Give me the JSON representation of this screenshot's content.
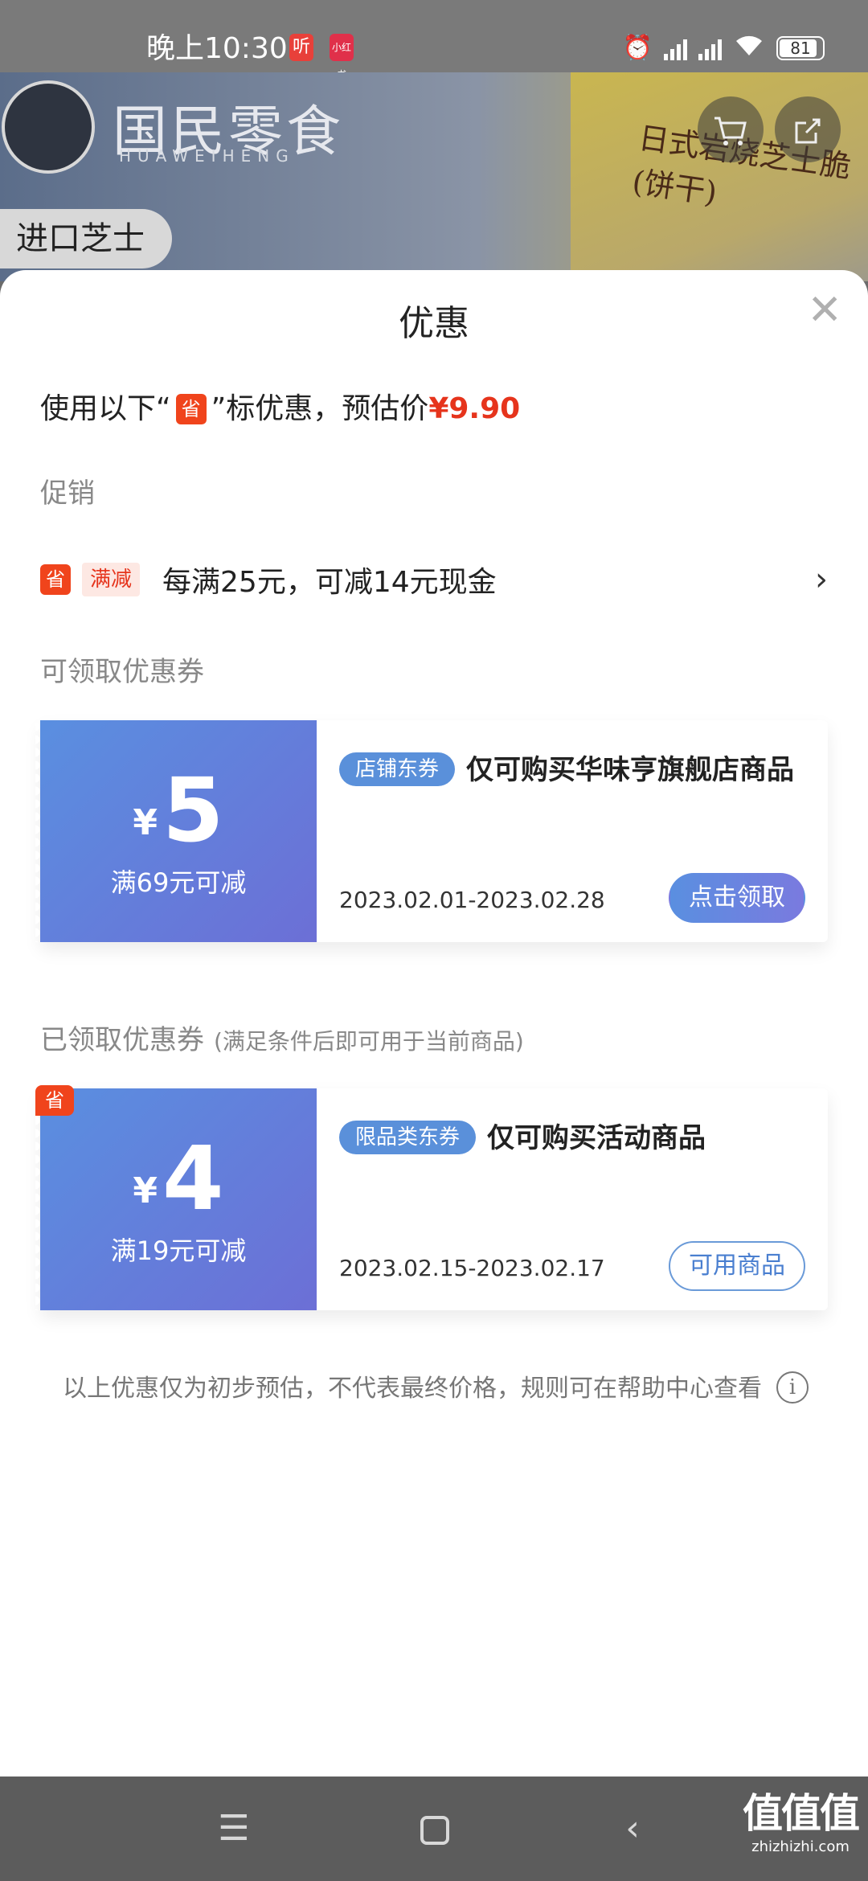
{
  "status_bar": {
    "time": "晚上10:30",
    "badge1": "听",
    "badge2": "小红书",
    "battery": "81"
  },
  "banner": {
    "brand": "国民零食",
    "brand_en": "HUAWEIHENG",
    "product_title": "日式岩烧芝士脆(饼干)",
    "tag": "进口芝士"
  },
  "sheet": {
    "title": "优惠",
    "estimate": {
      "prefix": "使用以下“",
      "badge": "省",
      "middle": "”标优惠，预估价",
      "price": "¥9.90"
    },
    "promo_section_label": "促销",
    "promo": {
      "badge": "省",
      "tag": "满减",
      "text": "每满25元，可减14元现金"
    },
    "available_section_label": "可领取优惠券",
    "available_coupon": {
      "yen": "¥",
      "amount": "5",
      "condition": "满69元可减",
      "type": "店铺东券",
      "title": "仅可购买华味亨旗舰店商品",
      "date": "2023.02.01-2023.02.28",
      "button": "点击领取"
    },
    "received_section_label": "已领取优惠券",
    "received_section_hint": "(满足条件后即可用于当前商品)",
    "received_coupon": {
      "corner_badge": "省",
      "yen": "¥",
      "amount": "4",
      "condition": "满19元可减",
      "type": "限品类东券",
      "title": "仅可购买活动商品",
      "date": "2023.02.15-2023.02.17",
      "button": "可用商品"
    },
    "footer_note": "以上优惠仅为初步预估，不代表最终价格，规则可在帮助中心查看"
  },
  "watermark": {
    "main": "值值值",
    "sub": "zhizhizhi.com"
  },
  "colors": {
    "accent_red": "#e6341c",
    "coupon_blue": "#5a8fe0",
    "coupon_purple": "#6c6fd6"
  },
  "icons": {
    "close": "close-icon",
    "arrow": "chevron-right-icon",
    "info": "info-icon",
    "cart": "cart-icon",
    "share": "share-icon"
  }
}
